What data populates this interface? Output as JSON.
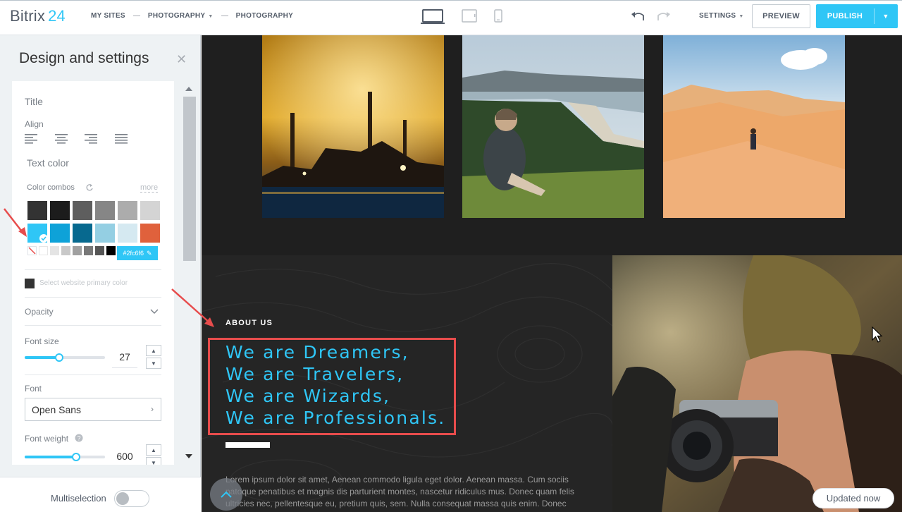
{
  "app": {
    "brand_name": "Bitrix",
    "brand_number": "24",
    "accent_color": "#2fc6f6",
    "annotation_color": "#e74c4c"
  },
  "breadcrumbs": [
    "MY SITES",
    "PHOTOGRAPHY",
    "PHOTOGRAPHY"
  ],
  "toolbar": {
    "devices": [
      "desktop-icon",
      "tablet-icon",
      "mobile-icon"
    ],
    "settings_label": "SETTINGS",
    "preview_label": "PREVIEW",
    "publish_label": "PUBLISH"
  },
  "panel": {
    "title": "Design and settings",
    "section_title": "Title",
    "align_label": "Align",
    "align_options": [
      "align-left-icon",
      "align-center-icon",
      "align-right-icon",
      "align-justify-icon"
    ],
    "text_color_label": "Text color",
    "color_combos_label": "Color combos",
    "more_label": "more",
    "swatches_row1": [
      "#333333",
      "#1c1c1c",
      "#5e5e5e",
      "#868686",
      "#acacac",
      "#d4d4d4"
    ],
    "swatches_row2": [
      "#2fc6f6",
      "#0ea2d8",
      "#07698f",
      "#94cfe3",
      "#d5e9f1",
      "#e0613c"
    ],
    "mini_swatches": [
      "#ffffff",
      "#e4e4e4",
      "#c8c8c8",
      "#a0a0a0",
      "#787878",
      "#555555",
      "#333333",
      "#000000"
    ],
    "selected_color": "#2fc6f6",
    "hex_value": "#2fc6f6",
    "primary_color_label": "Select website primary color",
    "opacity_label": "Opacity",
    "font_size_label": "Font size",
    "font_size_value": "27",
    "font_size_fraction": 0.43,
    "font_label": "Font",
    "font_value": "Open Sans",
    "font_weight_label": "Font weight",
    "font_weight_value": "600",
    "font_weight_fraction": 0.64,
    "multiselection_label": "Multiselection",
    "multiselection_on": false
  },
  "content": {
    "about_label": "ABOUT US",
    "headline_lines": [
      "We are Dreamers,",
      "We are Travelers,",
      "We are Wizards,",
      "We are Professionals."
    ],
    "lorem": "Lorem ipsum dolor sit amet, Aenean commodo ligula eget dolor. Aenean massa. Cum sociis natoque penatibus et magnis dis parturient montes, nascetur ridiculus mus. Donec quam felis ultricies nec, pellentesque eu, pretium quis, sem. Nulla consequat massa quis enim. Donec pede justo, fringilla vel, aliquet",
    "updated_label": "Updated now"
  }
}
